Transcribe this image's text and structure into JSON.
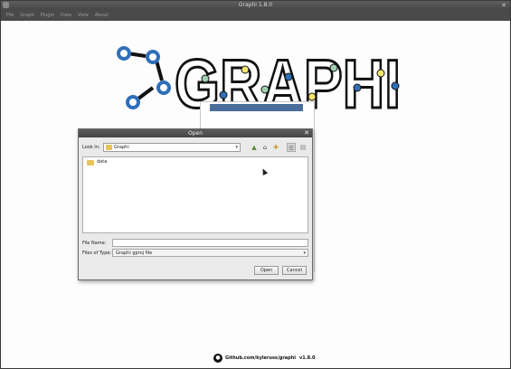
{
  "window": {
    "title": "Graphi 1.8.0"
  },
  "menu": {
    "items": [
      "File",
      "Graph",
      "Plugin",
      "Data",
      "View",
      "About"
    ]
  },
  "logo": {
    "text": "GRAPHI"
  },
  "dialog": {
    "title": "Open",
    "look_in_label": "Look In:",
    "look_in_value": "Graphi",
    "files": [
      {
        "name": "data",
        "type": "folder"
      }
    ],
    "file_name_label": "File Name:",
    "file_name_value": "",
    "files_of_type_label": "Files of Type:",
    "files_of_type_value": "Graphi gproj file",
    "open_label": "Open",
    "cancel_label": "Cancel"
  },
  "footer": {
    "link": "Github.com/kyleruss/graphi",
    "version": "v1.8.0"
  },
  "colors": {
    "accent": "#4a6c99",
    "logo_blue": "#2f6fb8",
    "node_green": "#9fd2b0",
    "node_yellow": "#f4e66b"
  }
}
